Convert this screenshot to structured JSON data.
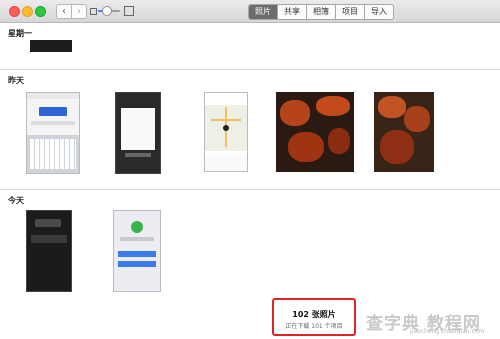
{
  "toolbar": {
    "tabs": [
      {
        "label": "照片",
        "active": true
      },
      {
        "label": "共享",
        "active": false
      },
      {
        "label": "相簿",
        "active": false
      },
      {
        "label": "项目",
        "active": false
      },
      {
        "label": "导入",
        "active": false
      }
    ]
  },
  "sections": [
    {
      "label": "星期一"
    },
    {
      "label": "昨天"
    },
    {
      "label": "今天"
    }
  ],
  "footer": {
    "title": "102 张照片",
    "subtitle": "正在下载 101 个项目"
  },
  "watermark": {
    "text": "查字典 教程网",
    "url": "jiaocheng.chazidian.com"
  },
  "colors": {
    "accent": "#3b8cf5",
    "highlight_border": "#e02424",
    "active_tab": "#6c6c6c"
  }
}
